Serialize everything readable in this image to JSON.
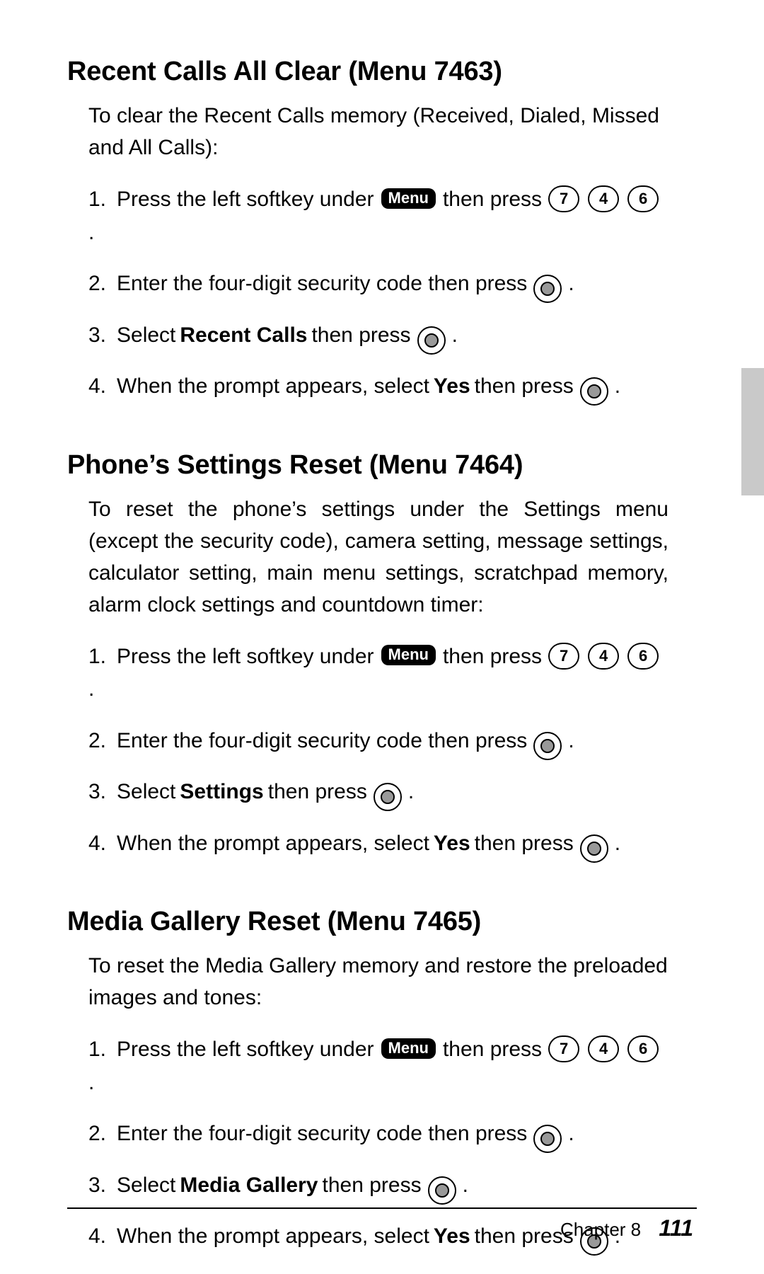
{
  "sections": [
    {
      "heading": "Recent Calls All Clear (Menu 7463)",
      "intro": "To clear the Recent Calls memory (Received, Dialed, Missed and All Calls):",
      "tight": false,
      "select_label": "Recent Calls"
    },
    {
      "heading": "Phone’s Settings Reset (Menu 7464)",
      "intro": "To reset the phone’s settings under the Settings menu (except the security code), camera setting, message settings, calculator setting, main menu settings, scratchpad memory, alarm clock settings and countdown timer:",
      "tight": true,
      "select_label": "Settings"
    },
    {
      "heading": "Media Gallery Reset (Menu 7465)",
      "intro": "To reset the Media Gallery memory and restore the preloaded images and tones:",
      "tight": false,
      "select_label": "Media Gallery"
    }
  ],
  "steps": {
    "s1a": "Press the left softkey under",
    "menu_label": "Menu",
    "s1b": "then press",
    "digits": [
      "7",
      "4",
      "6"
    ],
    "s2": "Enter the four-digit security code then press",
    "s3a": "Select",
    "s3b": "then press",
    "s4a": "When the prompt appears, select",
    "yes": "Yes",
    "s4b": "then press",
    "period": "."
  },
  "footer": {
    "chapter": "Chapter 8",
    "page": "111"
  }
}
